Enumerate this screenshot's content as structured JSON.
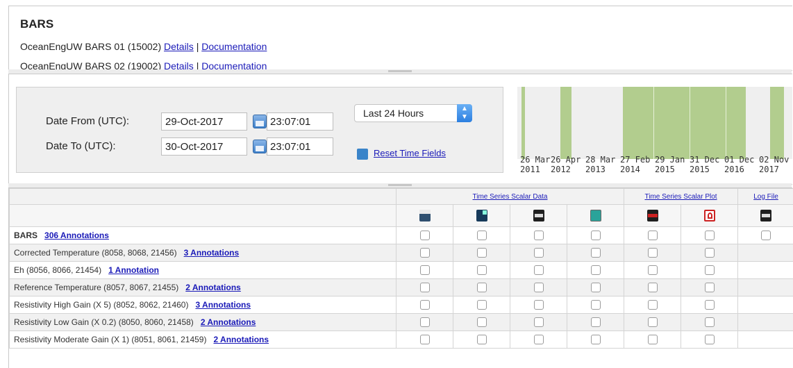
{
  "device_panel": {
    "title": "BARS",
    "devices": [
      {
        "name": "OceanEngUW BARS 01 (15002)",
        "details": "Details",
        "sep": "|",
        "docs": "Documentation"
      },
      {
        "name": "OceanEngUW BARS 02 (19002)",
        "details": "Details",
        "sep": "|",
        "docs": "Documentation"
      }
    ]
  },
  "time_controls": {
    "from_label": "Date From (UTC):",
    "from_date": "29-Oct-2017",
    "from_time": "23:07:01",
    "to_label": "Date To (UTC):",
    "to_date": "30-Oct-2017",
    "to_time": "23:07:01",
    "range_selected": "Last 24 Hours",
    "reset_label": "Reset Time Fields"
  },
  "timeline": {
    "segment_color": "#b2cd8e",
    "background_color": "#efefef",
    "labels": [
      {
        "top": "26 Mar",
        "bottom": "2011"
      },
      {
        "top": "26 Apr",
        "bottom": "2012"
      },
      {
        "top": "28 Mar",
        "bottom": "2013"
      },
      {
        "top": "27 Feb",
        "bottom": "2014"
      },
      {
        "top": "29 Jan",
        "bottom": "2015"
      },
      {
        "top": "31 Dec",
        "bottom": "2015"
      },
      {
        "top": "01 Dec",
        "bottom": "2016"
      },
      {
        "top": "02 Nov",
        "bottom": "2017"
      }
    ]
  },
  "table": {
    "group_headers": {
      "scalar_data": "Time Series Scalar Data",
      "scalar_plot": "Time Series Scalar Plot",
      "log_file": "Log File"
    },
    "icons": [
      "excel-icon",
      "matlab-icon",
      "csv-icon",
      "kml-icon",
      "png-plot-icon",
      "pdf-icon",
      "log-file-icon"
    ],
    "device_row": {
      "name": "BARS",
      "annotations": "306 Annotations"
    },
    "sensors": [
      {
        "name": "Corrected Temperature (8058, 8068, 21456)",
        "annotations": "3 Annotations"
      },
      {
        "name": "Eh (8056, 8066, 21454)",
        "annotations": "1 Annotation"
      },
      {
        "name": "Reference Temperature (8057, 8067, 21455)",
        "annotations": "2 Annotations"
      },
      {
        "name": "Resistivity High Gain (X 5) (8052, 8062, 21460)",
        "annotations": "3 Annotations"
      },
      {
        "name": "Resistivity Low Gain (X 0.2) (8050, 8060, 21458)",
        "annotations": "2 Annotations"
      },
      {
        "name": "Resistivity Moderate Gain (X 1) (8051, 8061, 21459)",
        "annotations": "2 Annotations"
      }
    ]
  }
}
